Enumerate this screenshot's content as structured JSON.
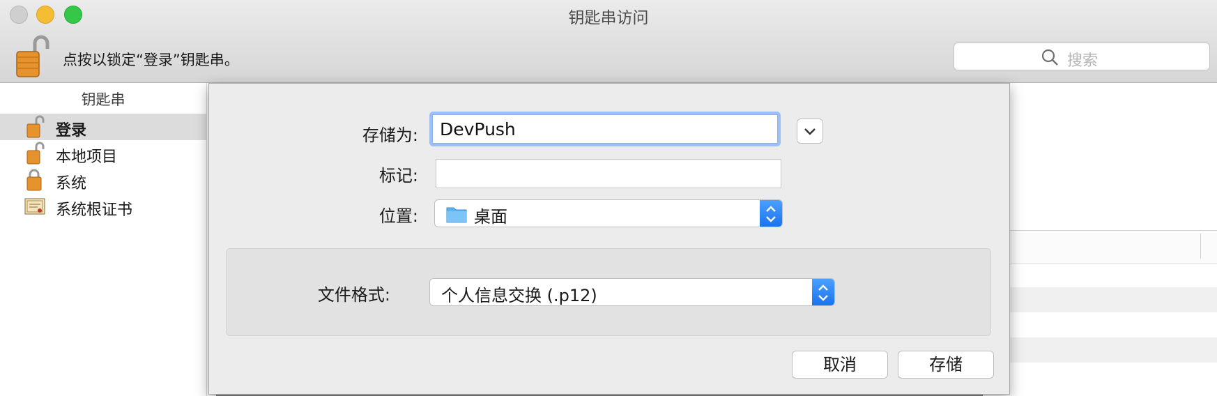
{
  "window": {
    "title": "钥匙串访问",
    "lock_message": "点按以锁定“登录”钥匙串。",
    "search_placeholder": "搜索"
  },
  "sidebar": {
    "header": "钥匙串",
    "items": [
      {
        "label": "登录",
        "icon": "unlocked-padlock-icon",
        "selected": true
      },
      {
        "label": "本地项目",
        "icon": "unlocked-padlock-icon",
        "selected": false
      },
      {
        "label": "系统",
        "icon": "locked-padlock-icon",
        "selected": false
      },
      {
        "label": "系统根证书",
        "icon": "certificate-icon",
        "selected": false
      }
    ]
  },
  "save_sheet": {
    "save_as_label": "存储为:",
    "save_as_value": "DevPush",
    "tags_label": "标记:",
    "tags_value": "",
    "where_label": "位置:",
    "where_value": "桌面",
    "format_label": "文件格式:",
    "format_value": "个人信息交换 (.p12)",
    "cancel_label": "取消",
    "save_label": "存储"
  },
  "colors": {
    "accent": "#1a73f0",
    "focus_ring": "#9cc0f5",
    "traffic_close": "#cfcfcf",
    "traffic_minimize": "#f5bd34",
    "traffic_zoom": "#34c748"
  }
}
